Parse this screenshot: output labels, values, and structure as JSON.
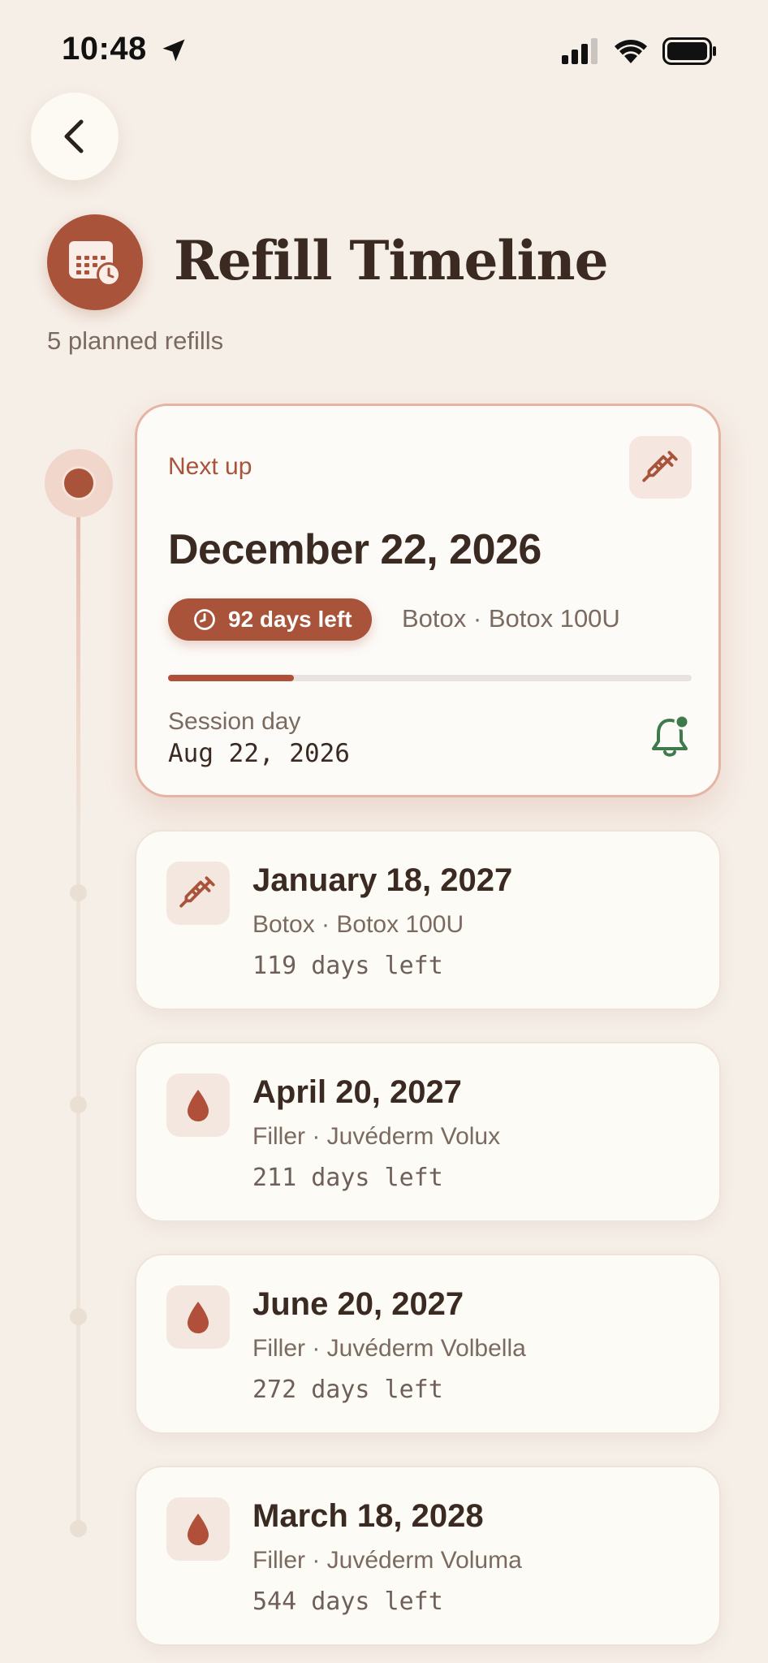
{
  "status_bar": {
    "time": "10:48"
  },
  "header": {
    "title": "Refill Timeline",
    "subtitle": "5 planned refills"
  },
  "featured": {
    "label": "Next up",
    "date": "December 22, 2026",
    "days_left": "92 days left",
    "product": "Botox · Botox 100U",
    "progress_fraction": 0.24,
    "session_label": "Session day",
    "session_date": "Aug 22, 2026",
    "icon": "syringe-icon"
  },
  "refills": [
    {
      "date": "January 18, 2027",
      "product": "Botox · Botox 100U",
      "days_left": "119 days left",
      "icon": "syringe-icon"
    },
    {
      "date": "April 20, 2027",
      "product": "Filler · Juvéderm Volux",
      "days_left": "211 days left",
      "icon": "drop-icon"
    },
    {
      "date": "June 20, 2027",
      "product": "Filler · Juvéderm Volbella",
      "days_left": "272 days left",
      "icon": "drop-icon"
    },
    {
      "date": "March 18, 2028",
      "product": "Filler · Juvéderm Voluma",
      "days_left": "544 days left",
      "icon": "drop-icon"
    }
  ],
  "colors": {
    "accent": "#a9533a",
    "background": "#f6efe8",
    "card": "#fdfbf6",
    "bell": "#3f7a4c"
  }
}
